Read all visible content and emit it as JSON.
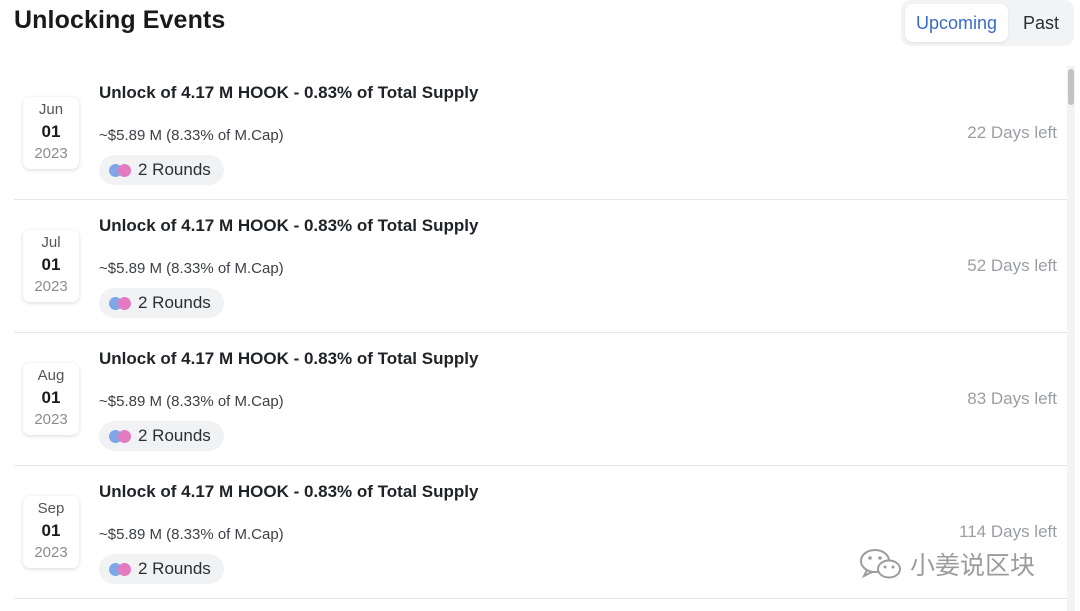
{
  "header": {
    "title": "Unlocking Events"
  },
  "tabs": [
    {
      "label": "Upcoming",
      "active": true
    },
    {
      "label": "Past",
      "active": false
    }
  ],
  "events": [
    {
      "month": "Jun",
      "day": "01",
      "year": "2023",
      "headline": "Unlock of 4.17 M HOOK - 0.83% of Total Supply",
      "value": "~$5.89 M (8.33% of M.Cap)",
      "rounds": "2 Rounds",
      "days_left": "22 Days left"
    },
    {
      "month": "Jul",
      "day": "01",
      "year": "2023",
      "headline": "Unlock of 4.17 M HOOK - 0.83% of Total Supply",
      "value": "~$5.89 M (8.33% of M.Cap)",
      "rounds": "2 Rounds",
      "days_left": "52 Days left"
    },
    {
      "month": "Aug",
      "day": "01",
      "year": "2023",
      "headline": "Unlock of 4.17 M HOOK - 0.83% of Total Supply",
      "value": "~$5.89 M (8.33% of M.Cap)",
      "rounds": "2 Rounds",
      "days_left": "83 Days left"
    },
    {
      "month": "Sep",
      "day": "01",
      "year": "2023",
      "headline": "Unlock of 4.17 M HOOK - 0.83% of Total Supply",
      "value": "~$5.89 M (8.33% of M.Cap)",
      "rounds": "2 Rounds",
      "days_left": "114 Days left"
    }
  ],
  "colors": {
    "accent": "#3a6cc7",
    "round_dot_1": "#7fa6e6",
    "round_dot_2": "#e47bc0"
  },
  "watermark": {
    "text": "小姜说区块",
    "icon": "wechat-icon"
  }
}
